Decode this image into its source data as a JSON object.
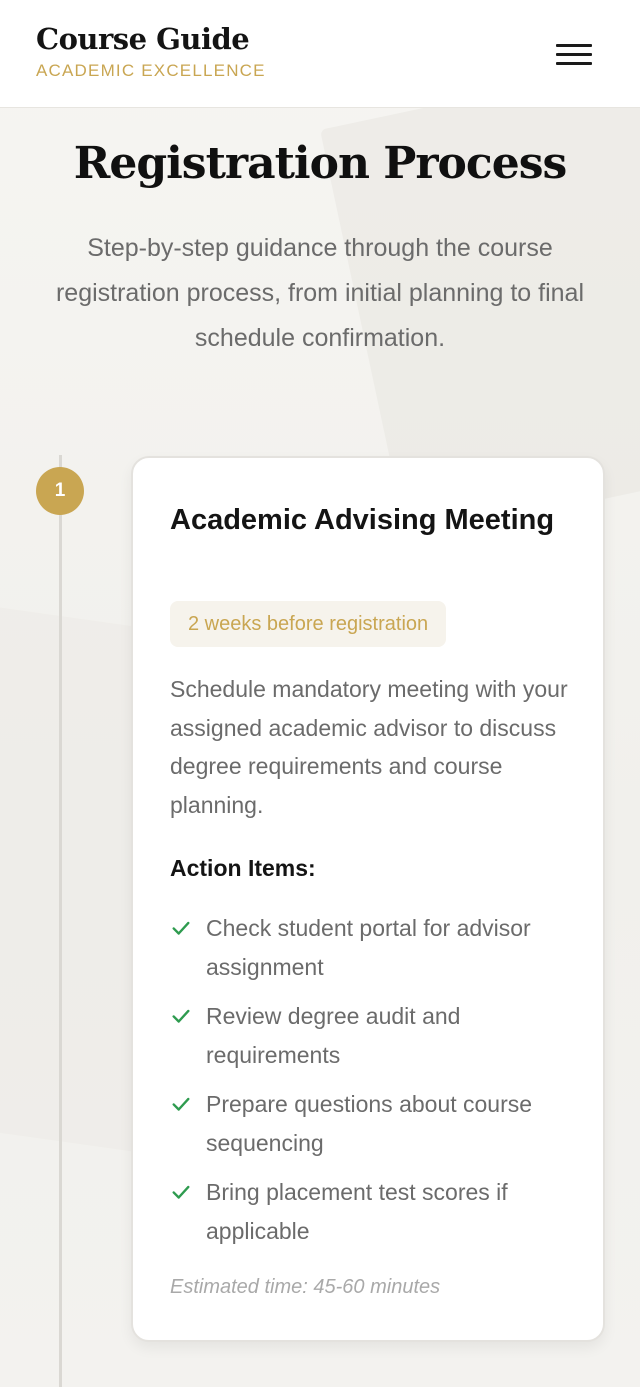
{
  "header": {
    "title": "Course Guide",
    "subtitle": "ACADEMIC EXCELLENCE",
    "menu_icon": "hamburger-menu-icon"
  },
  "hero": {
    "title": "Registration Process",
    "intro": "Step-by-step guidance through the course registration process, from initial planning to final schedule confirmation."
  },
  "steps": [
    {
      "number": "1",
      "title": "Academic Advising Meeting",
      "timing": "2 weeks before registration",
      "description": "Schedule mandatory meeting with your assigned academic advisor to discuss degree requirements and course planning.",
      "actions_heading": "Action Items:",
      "actions": [
        "Check student portal for advisor assignment",
        "Review degree audit and requirements",
        "Prepare questions about course sequencing",
        "Bring placement test scores if applicable"
      ],
      "estimate": "Estimated time: 45-60 minutes"
    }
  ],
  "colors": {
    "accent_gold": "#c9a652",
    "check_green": "#2e9b4f",
    "text_muted": "#6b6b6b"
  },
  "icons": {
    "check": "check-icon"
  }
}
